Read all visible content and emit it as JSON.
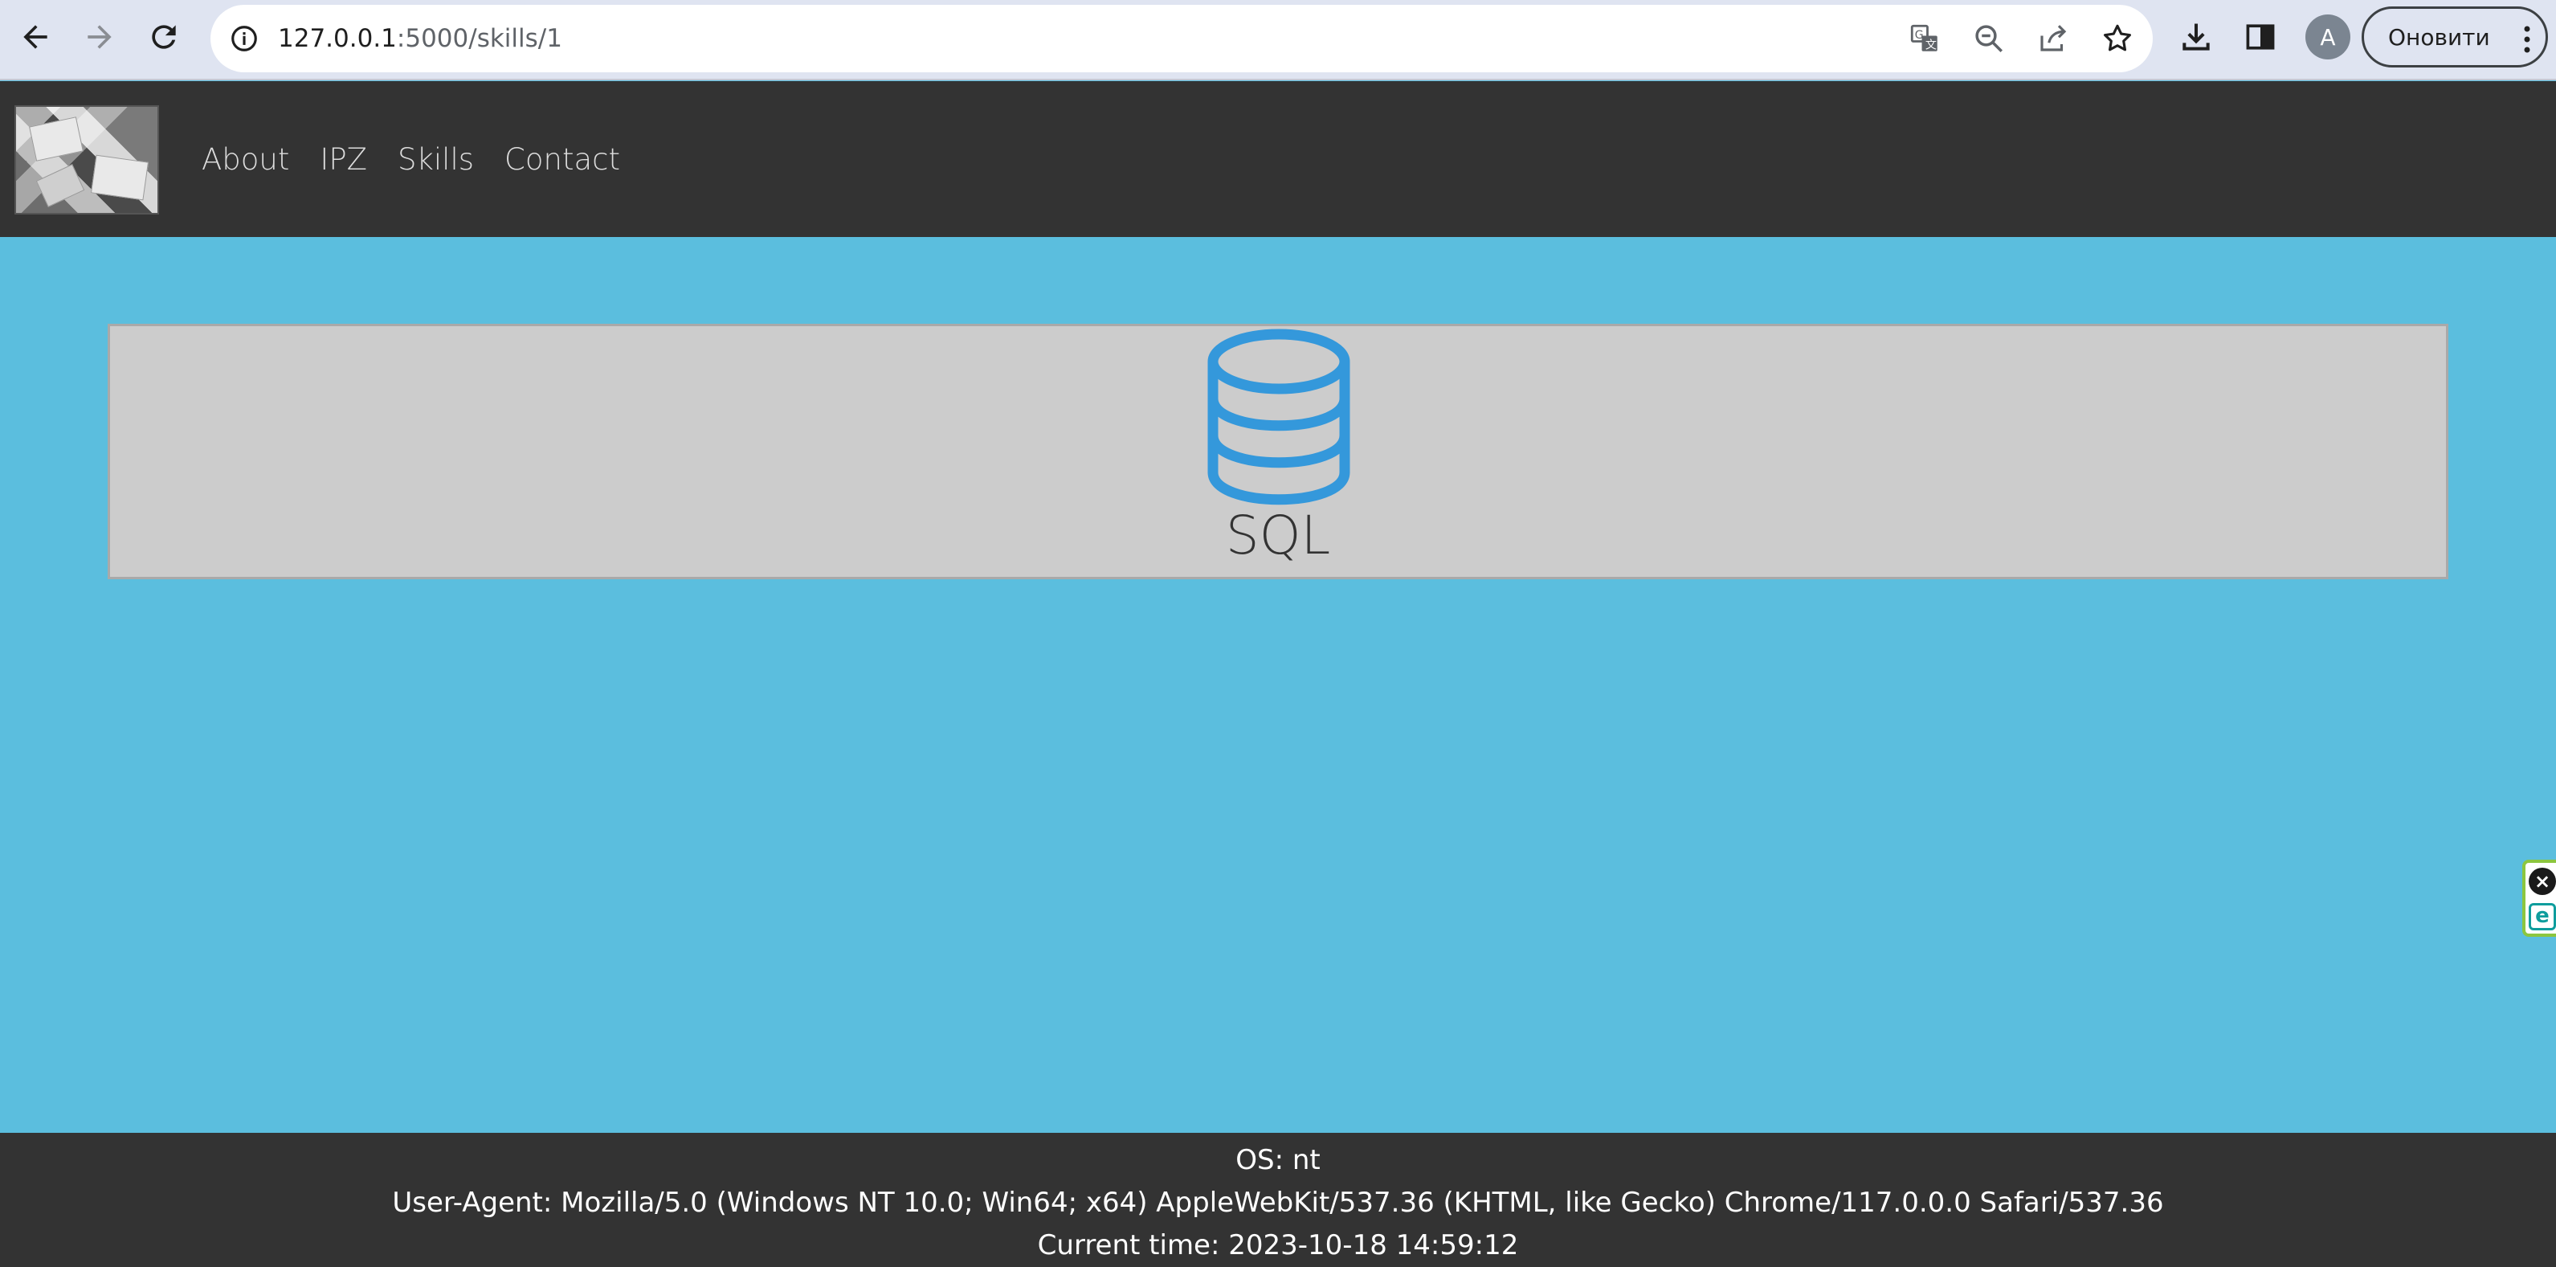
{
  "browser": {
    "url_host": "127.0.0.1",
    "url_path": ":5000/skills/1",
    "profile_initial": "A",
    "update_button_label": "Оновити",
    "icons": {
      "back": "back-arrow-icon",
      "forward": "forward-arrow-icon",
      "reload": "reload-icon",
      "site_info": "info-icon",
      "translate": "translate-icon",
      "zoom": "zoom-out-icon",
      "share": "share-icon",
      "bookmark": "star-icon",
      "downloads": "download-icon",
      "side_panel": "side-panel-icon",
      "menu": "more-vert-icon"
    }
  },
  "nav": {
    "logo": "site-logo",
    "links": [
      {
        "label": "About"
      },
      {
        "label": "IPZ"
      },
      {
        "label": "Skills"
      },
      {
        "label": "Contact"
      }
    ]
  },
  "skill": {
    "name": "SQL",
    "icon": "database-icon",
    "icon_color": "#3498db"
  },
  "footer": {
    "os": "OS: nt",
    "user_agent": "User-Agent: Mozilla/5.0 (Windows NT 10.0; Win64; x64) AppleWebKit/537.36 (KHTML, like Gecko) Chrome/117.0.0.0 Safari/537.36",
    "time": "Current time: 2023-10-18 14:59:12"
  },
  "colors": {
    "page_bg": "#5bbede",
    "navbar_bg": "#333333",
    "card_bg": "#cccccc",
    "footer_bg": "#333333"
  }
}
